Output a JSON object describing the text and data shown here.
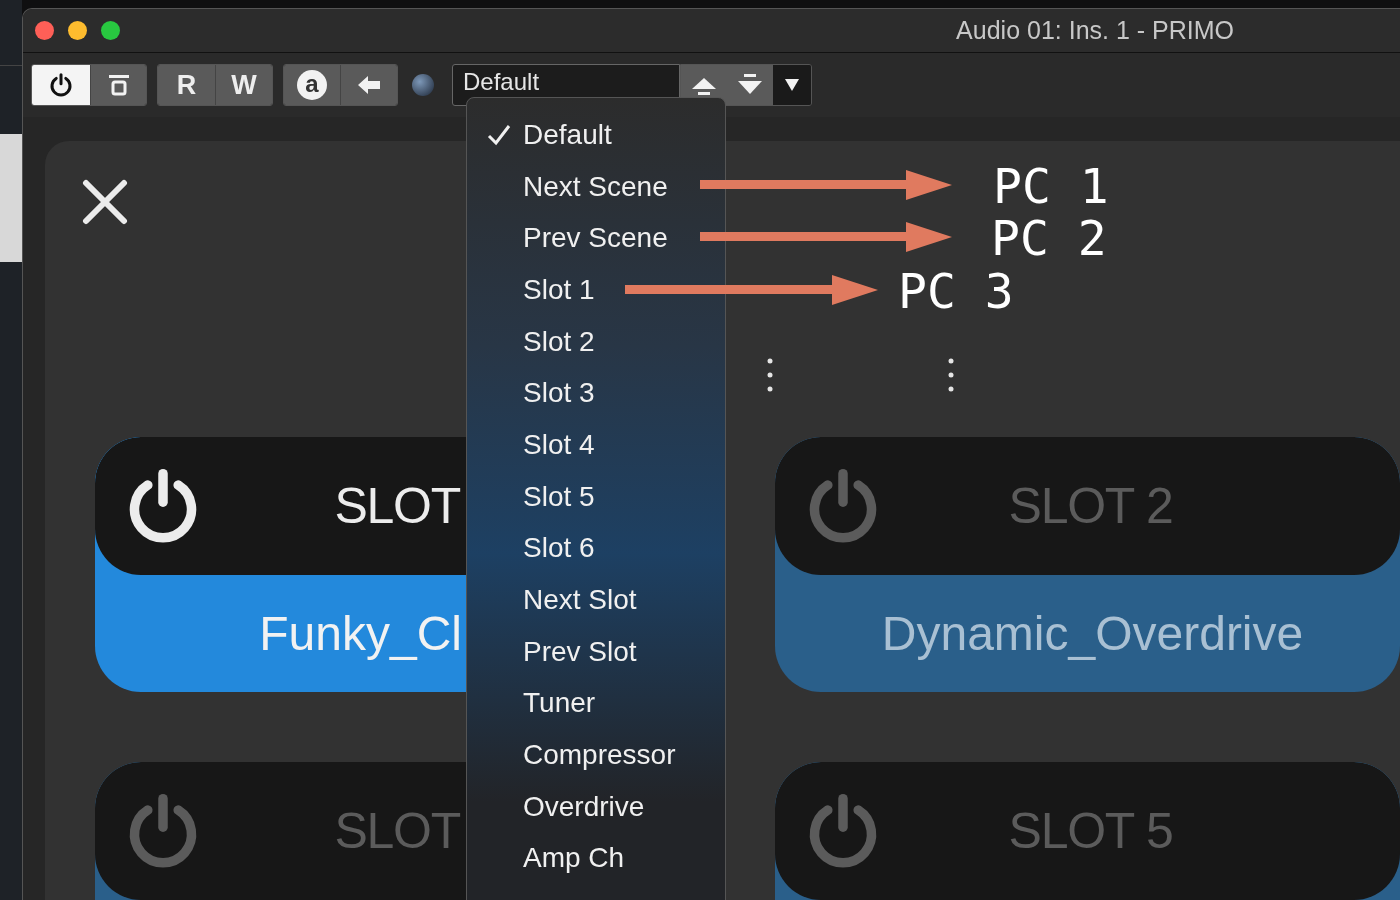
{
  "window": {
    "title": "Audio 01: Ins. 1 - PRIMO"
  },
  "toolbar": {
    "power_on": true,
    "read_label": "R",
    "write_label": "W",
    "auto_label": "a",
    "preset": "Default"
  },
  "preset_menu": {
    "items": [
      {
        "label": "Default",
        "checked": true
      },
      {
        "label": "Next Scene",
        "checked": false
      },
      {
        "label": "Prev Scene",
        "checked": false
      },
      {
        "label": "Slot 1",
        "checked": false
      },
      {
        "label": "Slot 2",
        "checked": false
      },
      {
        "label": "Slot 3",
        "checked": false
      },
      {
        "label": "Slot 4",
        "checked": false
      },
      {
        "label": "Slot 5",
        "checked": false
      },
      {
        "label": "Slot 6",
        "checked": false
      },
      {
        "label": "Next Slot",
        "checked": false
      },
      {
        "label": "Prev Slot",
        "checked": false
      },
      {
        "label": "Tuner",
        "checked": false
      },
      {
        "label": "Compressor",
        "checked": false
      },
      {
        "label": "Overdrive",
        "checked": false
      },
      {
        "label": "Amp Ch",
        "checked": false
      }
    ]
  },
  "annotations": [
    {
      "label": "PC 1"
    },
    {
      "label": "PC 2"
    },
    {
      "label": "PC 3"
    }
  ],
  "slots": [
    {
      "title": "SLOT",
      "preset": "Funky_Cl",
      "on": true
    },
    {
      "title": "SLOT 2",
      "preset": "Dynamic_Overdrive",
      "on": false
    },
    {
      "title": "SLOT",
      "on": false
    },
    {
      "title": "SLOT 5",
      "on": false
    }
  ]
}
